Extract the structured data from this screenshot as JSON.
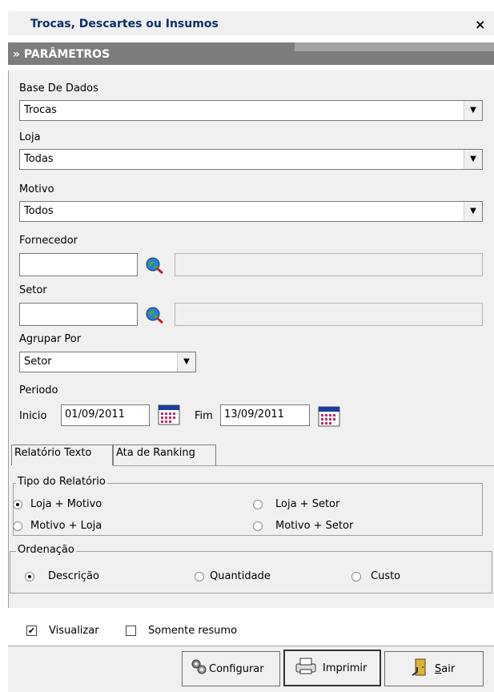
{
  "window": {
    "title": "Trocas, Descartes ou Insumos",
    "close": "×"
  },
  "section": {
    "title": "» PARÂMETROS"
  },
  "fields": {
    "base_label": "Base De Dados",
    "base_value": "Trocas",
    "loja_label": "Loja",
    "loja_value": "Todas",
    "motivo_label": "Motivo",
    "motivo_value": "Todos",
    "fornecedor_label": "Fornecedor",
    "fornecedor_value": "",
    "fornecedor_desc": "",
    "setor_label": "Setor",
    "setor_value": "",
    "setor_desc": "",
    "agrupar_label": "Agrupar Por",
    "agrupar_value": "Setor",
    "periodo_label": "Periodo",
    "inicio_label": "Inicio",
    "inicio_value": "01/09/2011",
    "fim_label": "Fim",
    "fim_value": "13/09/2011"
  },
  "tabs": [
    {
      "label": "Relatório Texto",
      "active": true
    },
    {
      "label": "Ata de Ranking",
      "active": false
    }
  ],
  "tipo": {
    "label": "Tipo do Relatório",
    "options": [
      {
        "label": "Loja + Motivo",
        "selected": true
      },
      {
        "label": "Loja + Setor",
        "selected": false
      },
      {
        "label": "Motivo + Loja",
        "selected": false
      },
      {
        "label": "Motivo + Setor",
        "selected": false
      }
    ]
  },
  "ordenacao": {
    "label": "Ordenação",
    "options": [
      {
        "label": "Descrição",
        "selected": true
      },
      {
        "label": "Quantidade",
        "selected": false
      },
      {
        "label": "Custo",
        "selected": false
      }
    ]
  },
  "checks": {
    "visualizar": {
      "label": "Visualizar",
      "checked": true
    },
    "resumo": {
      "label": "Somente resumo",
      "checked": false
    }
  },
  "buttons": {
    "configurar": "Configurar",
    "imprimir": "Imprimir",
    "sair_rest": "air",
    "sair_underline": "S"
  },
  "icons": {
    "search": "search-icon",
    "calendar": "calendar-icon",
    "gear": "gear-icon",
    "printer": "printer-icon",
    "exit": "exit-door-icon"
  },
  "colors": {
    "title": "#0c2f6a",
    "section_bg": "#7d7d7d",
    "panel_bg": "#f0f0f0"
  }
}
